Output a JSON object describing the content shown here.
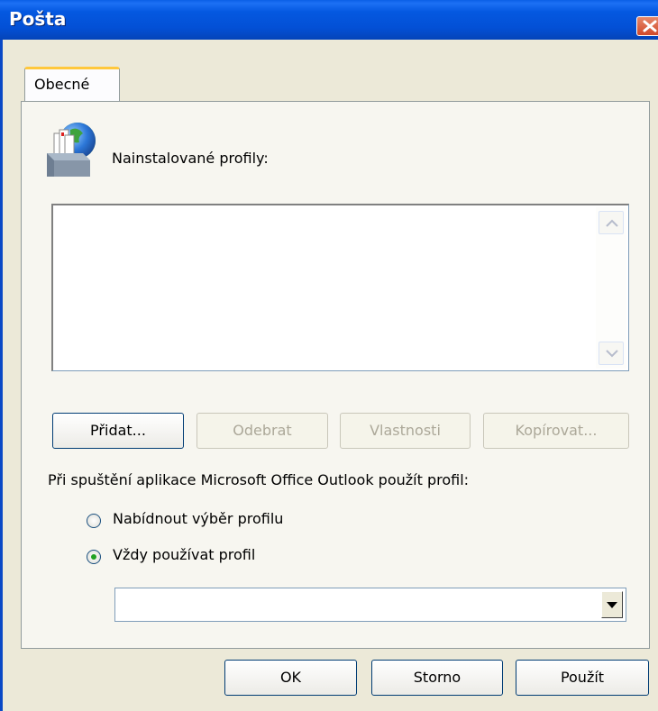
{
  "window": {
    "title": "Pošta"
  },
  "tabs": [
    {
      "label": "Obecné"
    }
  ],
  "profiles": {
    "label": "Nainstalované profily:",
    "items": []
  },
  "buttons": {
    "add": "Přidat...",
    "remove": "Odebrat",
    "properties": "Vlastnosti",
    "copy": "Kopírovat..."
  },
  "startup": {
    "label": "Při spuštění aplikace Microsoft Office Outlook použít profil:",
    "option_prompt": "Nabídnout výběr profilu",
    "option_always": "Vždy používat profil",
    "selected": "always",
    "profile_value": ""
  },
  "footer": {
    "ok": "OK",
    "cancel": "Storno",
    "apply": "Použít"
  },
  "icons": {
    "close": "close-icon",
    "profile": "mail-profile-icon"
  },
  "colors": {
    "titlebar": "#0458E0",
    "dialog": "#ECE9D8",
    "tab_accent": "#FFC83C",
    "close": "#D2492A"
  }
}
